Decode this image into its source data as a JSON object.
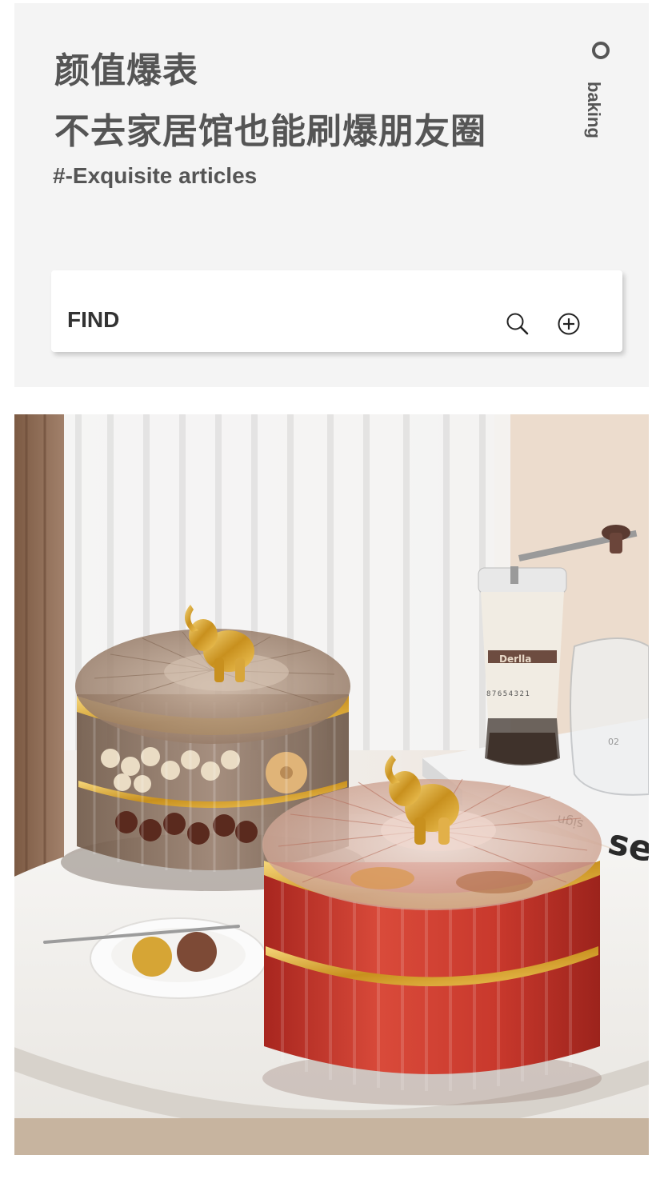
{
  "header": {
    "headline_line1": "颜值爆表",
    "headline_line2": "不去家居馆也能刷爆朋友圈",
    "subtitle": "#-Exquisite articles",
    "side_word": "baking"
  },
  "search": {
    "label": "FIND",
    "search_icon": "magnifier-icon",
    "add_icon": "plus-circle-icon"
  },
  "photo": {
    "grinder_brand": "Derlla",
    "grinder_scale": "87654321",
    "book_text": "sei",
    "book_text_2": "sign",
    "jug_mark": "02"
  },
  "colors": {
    "text": "#555555",
    "panel": "#f4f4f4",
    "red_box": "#c4332a",
    "amber_box": "#8a6b52",
    "gold": "#d4a12a"
  }
}
